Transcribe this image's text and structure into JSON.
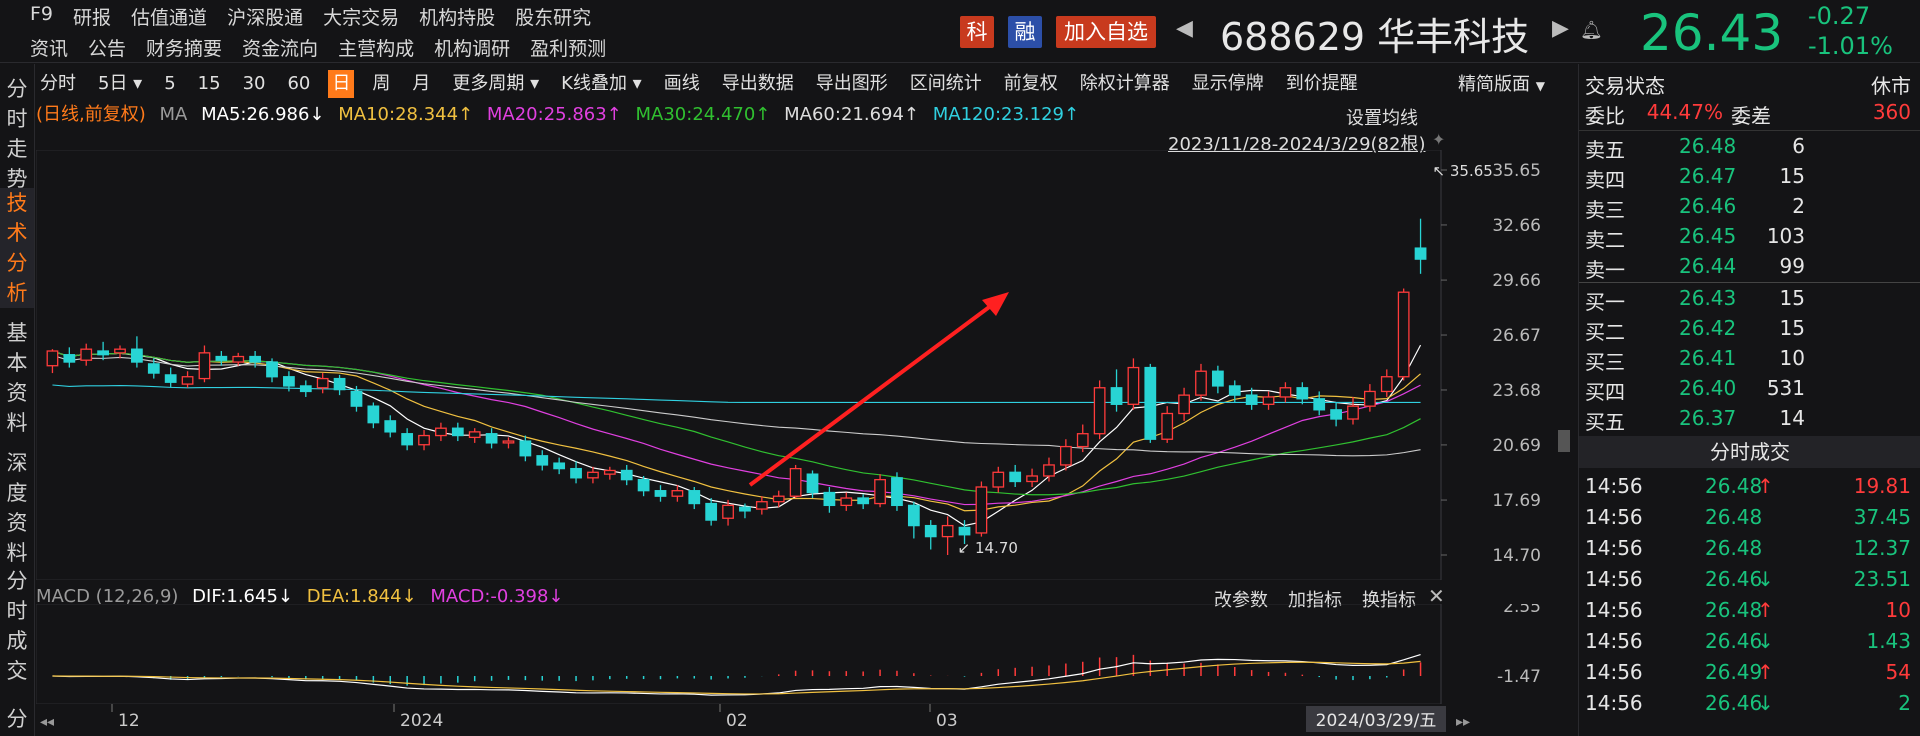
{
  "topbar": {
    "menu_row1": [
      "F9",
      "研报",
      "估值通道",
      "沪深股通",
      "大宗交易",
      "机构持股",
      "股东研究"
    ],
    "menu_row2": [
      "资讯",
      "公告",
      "财务摘要",
      "资金流向",
      "主营构成",
      "机构调研",
      "盈利预测"
    ],
    "tag_ke": "科",
    "tag_rong": "融",
    "add_watch": "加入自选",
    "stock": "688629 华丰科技",
    "price": "26.43",
    "change": "-0.27",
    "change_pct": "-1.01%",
    "colors": {
      "up": "#ff3b3b",
      "down": "#19c37d",
      "accent": "#ff7a1a"
    }
  },
  "left_tabs": [
    "分时走势",
    "技术分析",
    "基本资料",
    "深度资料",
    "分时成交",
    "分"
  ],
  "toolbar": {
    "items": [
      "分时",
      "5日",
      "5",
      "15",
      "30",
      "60",
      "日",
      "周",
      "月",
      "更多周期",
      "K线叠加",
      "画线",
      "导出数据",
      "导出图形",
      "区间统计",
      "前复权",
      "除权计算器",
      "显示停牌",
      "到价提醒"
    ],
    "selected": "日",
    "mode": "精简版面"
  },
  "ma_row": {
    "label": "(日线,前复权)",
    "ma": "MA",
    "ma5": "MA5:26.986↓",
    "ma10": "MA10:28.344↑",
    "ma20": "MA20:25.863↑",
    "ma30": "MA30:24.470↑",
    "ma60": "MA60:21.694↑",
    "ma120": "MA120:23.129↑",
    "setting": "设置均线",
    "range": "2023/11/28-2024/3/29(82根)"
  },
  "chart_data": {
    "type": "candlestick",
    "price_ticks": [
      "35.65",
      "32.66",
      "29.66",
      "26.67",
      "23.68",
      "20.69",
      "17.69",
      "14.70"
    ],
    "ylim": [
      14.7,
      35.65
    ],
    "x_labels": [
      "12",
      "2024",
      "02",
      "03"
    ],
    "current_date": "2024/03/29/五",
    "max_label": "35.65",
    "min_label": "14.70",
    "candles": [
      [
        25.0,
        25.8,
        24.6,
        25.9
      ],
      [
        25.6,
        25.2,
        24.9,
        26.0
      ],
      [
        25.3,
        25.9,
        25.0,
        26.2
      ],
      [
        25.8,
        25.6,
        25.3,
        26.3
      ],
      [
        25.7,
        25.9,
        25.4,
        26.1
      ],
      [
        25.9,
        25.2,
        24.9,
        26.6
      ],
      [
        25.1,
        24.6,
        24.3,
        25.4
      ],
      [
        24.5,
        24.1,
        23.8,
        24.9
      ],
      [
        24.0,
        24.4,
        23.8,
        24.7
      ],
      [
        24.3,
        25.7,
        24.1,
        26.1
      ],
      [
        25.5,
        25.3,
        25.0,
        25.8
      ],
      [
        25.2,
        25.5,
        25.0,
        25.7
      ],
      [
        25.5,
        25.2,
        24.9,
        25.8
      ],
      [
        25.2,
        24.4,
        24.1,
        25.4
      ],
      [
        24.4,
        23.9,
        23.6,
        24.7
      ],
      [
        23.9,
        23.6,
        23.3,
        24.2
      ],
      [
        23.8,
        24.3,
        23.5,
        24.6
      ],
      [
        24.3,
        23.7,
        23.4,
        24.5
      ],
      [
        23.6,
        22.8,
        22.5,
        23.9
      ],
      [
        22.8,
        21.9,
        21.6,
        23.0
      ],
      [
        22.0,
        21.4,
        21.1,
        22.3
      ],
      [
        21.3,
        20.7,
        20.4,
        21.6
      ],
      [
        20.7,
        21.2,
        20.4,
        21.5
      ],
      [
        21.2,
        21.6,
        20.9,
        21.9
      ],
      [
        21.6,
        21.2,
        20.9,
        21.9
      ],
      [
        21.1,
        21.4,
        20.8,
        21.6
      ],
      [
        21.3,
        20.8,
        20.5,
        21.6
      ],
      [
        20.8,
        20.9,
        20.5,
        21.1
      ],
      [
        20.9,
        20.1,
        19.8,
        21.2
      ],
      [
        20.1,
        19.6,
        19.3,
        20.4
      ],
      [
        19.7,
        19.4,
        19.1,
        20.0
      ],
      [
        19.4,
        18.9,
        18.6,
        19.8
      ],
      [
        18.9,
        19.2,
        18.6,
        19.5
      ],
      [
        19.1,
        19.3,
        18.8,
        19.5
      ],
      [
        19.3,
        18.8,
        18.5,
        19.6
      ],
      [
        18.8,
        18.2,
        17.9,
        19.0
      ],
      [
        18.2,
        17.9,
        17.6,
        18.5
      ],
      [
        17.9,
        18.2,
        17.6,
        18.5
      ],
      [
        18.2,
        17.5,
        17.2,
        18.4
      ],
      [
        17.5,
        16.6,
        16.3,
        17.8
      ],
      [
        16.7,
        17.4,
        16.3,
        17.7
      ],
      [
        17.3,
        17.1,
        16.7,
        17.5
      ],
      [
        17.2,
        17.6,
        16.9,
        17.9
      ],
      [
        17.6,
        17.9,
        17.3,
        18.2
      ],
      [
        17.9,
        19.4,
        17.8,
        19.6
      ],
      [
        19.1,
        18.1,
        17.8,
        19.3
      ],
      [
        18.1,
        17.4,
        17.0,
        18.4
      ],
      [
        17.4,
        17.8,
        17.1,
        18.1
      ],
      [
        17.8,
        17.5,
        17.2,
        18.0
      ],
      [
        17.5,
        18.8,
        17.3,
        19.1
      ],
      [
        18.9,
        17.4,
        17.1,
        19.2
      ],
      [
        17.4,
        16.3,
        15.6,
        17.6
      ],
      [
        16.3,
        15.7,
        15.0,
        16.6
      ],
      [
        15.7,
        16.3,
        14.7,
        16.8
      ],
      [
        16.2,
        15.8,
        15.3,
        16.6
      ],
      [
        15.9,
        18.4,
        15.7,
        18.7
      ],
      [
        18.4,
        19.2,
        18.1,
        19.5
      ],
      [
        19.2,
        18.7,
        18.4,
        19.6
      ],
      [
        18.7,
        19.0,
        18.4,
        19.4
      ],
      [
        19.0,
        19.6,
        18.7,
        20.0
      ],
      [
        19.6,
        20.6,
        19.3,
        21.0
      ],
      [
        20.6,
        21.3,
        20.3,
        21.8
      ],
      [
        21.3,
        23.8,
        21.0,
        24.2
      ],
      [
        23.8,
        22.9,
        22.5,
        24.8
      ],
      [
        22.9,
        24.9,
        22.6,
        25.4
      ],
      [
        24.9,
        21.0,
        20.8,
        25.1
      ],
      [
        21.0,
        22.4,
        20.8,
        22.8
      ],
      [
        22.4,
        23.4,
        22.0,
        23.8
      ],
      [
        23.4,
        24.7,
        23.1,
        25.1
      ],
      [
        24.7,
        23.9,
        23.5,
        25.0
      ],
      [
        23.9,
        23.4,
        23.0,
        24.2
      ],
      [
        23.4,
        22.9,
        22.6,
        23.8
      ],
      [
        22.9,
        23.3,
        22.6,
        23.6
      ],
      [
        23.3,
        23.8,
        23.0,
        24.1
      ],
      [
        23.8,
        23.2,
        22.9,
        24.1
      ],
      [
        23.2,
        22.6,
        22.3,
        23.6
      ],
      [
        22.6,
        22.1,
        21.7,
        23.0
      ],
      [
        22.1,
        22.8,
        21.8,
        23.3
      ],
      [
        22.8,
        23.6,
        22.5,
        24.0
      ],
      [
        23.6,
        24.4,
        23.3,
        24.8
      ],
      [
        24.4,
        29.0,
        24.2,
        29.2
      ],
      [
        31.4,
        30.8,
        30.0,
        33.0
      ]
    ]
  },
  "macd": {
    "label": "MACD (12,26,9)",
    "dif": "DIF:1.645↓",
    "dea": "DEA:1.844↓",
    "macd": "MACD:-0.398↓",
    "ctl1": "改参数",
    "ctl2": "加指标",
    "ctl3": "换指标",
    "ticks": [
      "2.55",
      "-1.47"
    ]
  },
  "right_panel": {
    "status_label": "交易状态",
    "status_value": "休市",
    "weibi_label": "委比",
    "weibi": "44.47%",
    "weicha_label": "委差",
    "weicha": "360",
    "asks": [
      {
        "label": "卖五",
        "price": "26.48",
        "vol": "6"
      },
      {
        "label": "卖四",
        "price": "26.47",
        "vol": "15"
      },
      {
        "label": "卖三",
        "price": "26.46",
        "vol": "2"
      },
      {
        "label": "卖二",
        "price": "26.45",
        "vol": "103"
      },
      {
        "label": "卖一",
        "price": "26.44",
        "vol": "99"
      }
    ],
    "bids": [
      {
        "label": "买一",
        "price": "26.43",
        "vol": "15"
      },
      {
        "label": "买二",
        "price": "26.42",
        "vol": "15"
      },
      {
        "label": "买三",
        "price": "26.41",
        "vol": "10"
      },
      {
        "label": "买四",
        "price": "26.40",
        "vol": "531"
      },
      {
        "label": "买五",
        "price": "26.37",
        "vol": "14"
      }
    ],
    "trades_title": "分时成交",
    "trades": [
      {
        "t": "14:56",
        "p": "26.48",
        "a": "↑",
        "v": "19.81",
        "c": "red"
      },
      {
        "t": "14:56",
        "p": "26.48",
        "a": "",
        "v": "37.45",
        "c": "green"
      },
      {
        "t": "14:56",
        "p": "26.48",
        "a": "",
        "v": "12.37",
        "c": "green"
      },
      {
        "t": "14:56",
        "p": "26.46",
        "a": "↓",
        "v": "23.51",
        "c": "green"
      },
      {
        "t": "14:56",
        "p": "26.48",
        "a": "↑",
        "v": "10",
        "c": "red"
      },
      {
        "t": "14:56",
        "p": "26.46",
        "a": "↓",
        "v": "1.43",
        "c": "green"
      },
      {
        "t": "14:56",
        "p": "26.49",
        "a": "↑",
        "v": "54",
        "c": "red"
      },
      {
        "t": "14:56",
        "p": "26.46",
        "a": "↓",
        "v": "2",
        "c": "green"
      }
    ]
  }
}
